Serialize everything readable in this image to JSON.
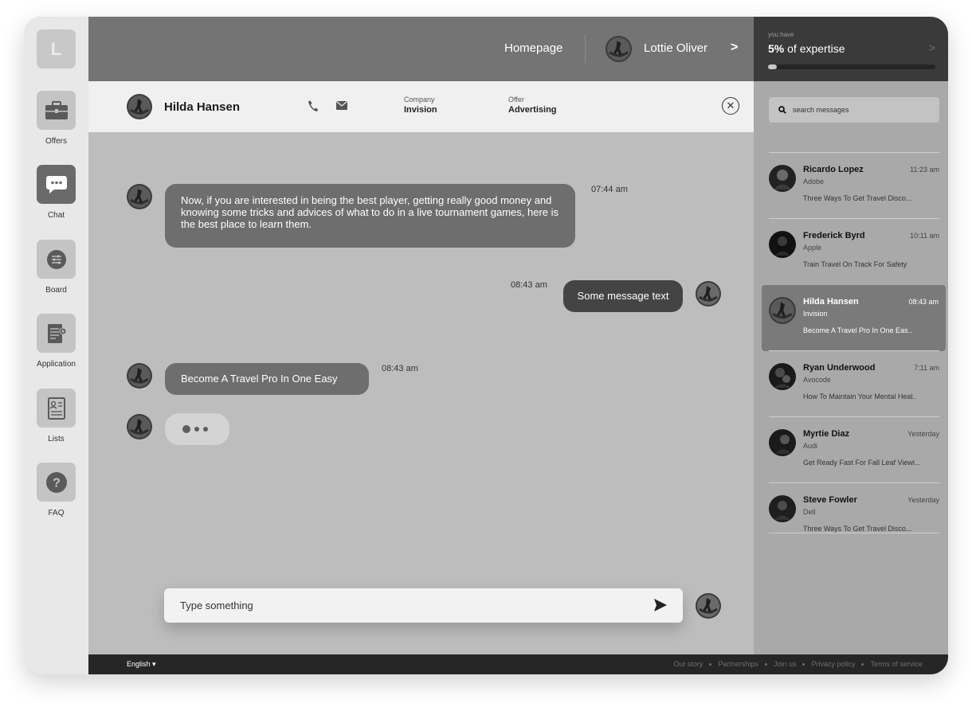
{
  "app": {
    "logo_letter": "L"
  },
  "nav": {
    "items": [
      {
        "label": "Offers",
        "icon": "briefcase-icon"
      },
      {
        "label": "Chat",
        "icon": "chat-bubble-icon",
        "active": true
      },
      {
        "label": "Board",
        "icon": "sliders-icon"
      },
      {
        "label": "Application",
        "icon": "document-plus-icon"
      },
      {
        "label": "Lists",
        "icon": "id-card-icon"
      },
      {
        "label": "FAQ",
        "icon": "question-icon"
      }
    ]
  },
  "topbar": {
    "homepage_label": "Homepage",
    "user_name": "Lottie Oliver",
    "chevron": ">"
  },
  "expertise": {
    "small_label": "you have",
    "percent_text": "5%",
    "suffix": " of expertise",
    "progress_percent": 5
  },
  "contact": {
    "name": "Hilda Hansen",
    "company_label": "Company",
    "company_value": "Invision",
    "offer_label": "Offer",
    "offer_value": "Advertising"
  },
  "messages": [
    {
      "direction": "in",
      "text": "Now, if you are interested in being the best player, getting really good money and knowing some tricks and advices of what to do in a live tournament games, here is the best place to learn them.",
      "time": "07:44 am"
    },
    {
      "direction": "out",
      "text": "Some message text",
      "time": "08:43 am"
    },
    {
      "direction": "in",
      "text": "Become A Travel Pro In One Easy",
      "time": "08:43 am"
    }
  ],
  "composer": {
    "placeholder": "Type something"
  },
  "search": {
    "placeholder": "search messages"
  },
  "conversations": [
    {
      "name": "Ricardo Lopez",
      "time": "11:23 am",
      "company": "Adobe",
      "preview": "Three Ways To Get Travel Disco..."
    },
    {
      "name": "Frederick Byrd",
      "time": "10:11 am",
      "company": "Apple",
      "preview": "Train Travel On Track For Safety"
    },
    {
      "name": "Hilda Hansen",
      "time": "08:43 am",
      "company": "Invision",
      "preview": "Become A Travel Pro In One Eas..",
      "active": true
    },
    {
      "name": "Ryan Underwood",
      "time": "7:11 am",
      "company": "Avocode",
      "preview": "How To Maintain Your Mental Heal.."
    },
    {
      "name": "Myrtie Diaz",
      "time": "Yesterday",
      "company": "Audi",
      "preview": "Get Ready Fast For Fall Leaf Viewi..."
    },
    {
      "name": "Steve Fowler",
      "time": "Yesterday",
      "company": "Dell",
      "preview": "Three Ways To Get Travel Disco..."
    }
  ],
  "footer": {
    "language": "English",
    "links": [
      "Our story",
      "Partnerships",
      "Join us",
      "Privacy policy",
      "Terms of service"
    ]
  },
  "colors": {
    "nav_bg": "#e8e8e8",
    "topbar_bg": "#747474",
    "expertise_bg": "#3a3a3a",
    "chat_bg": "#bdbdbd",
    "panel_bg": "#a9a9a9",
    "bubble_in": "#6e6e6e",
    "bubble_out": "#444444",
    "footer_bg": "#262626"
  }
}
